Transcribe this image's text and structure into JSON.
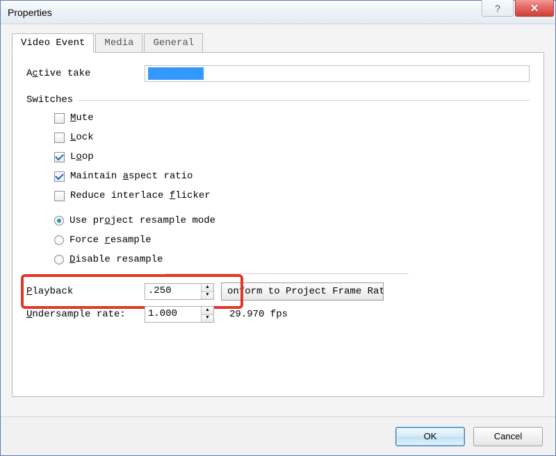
{
  "window": {
    "title": "Properties"
  },
  "tabs": [
    {
      "label": "Video Event",
      "active": true
    },
    {
      "label": "Media",
      "active": false
    },
    {
      "label": "General",
      "active": false
    }
  ],
  "active_take": {
    "label_pre": "A",
    "label_u": "c",
    "label_post": "tive take",
    "value": ""
  },
  "switches": {
    "label": "Switches",
    "mute": {
      "pre": "",
      "u": "M",
      "post": "ute",
      "checked": false
    },
    "lock": {
      "pre": "",
      "u": "L",
      "post": "ock",
      "checked": false
    },
    "loop": {
      "pre": "L",
      "u": "o",
      "post": "op",
      "checked": true
    },
    "aspect": {
      "pre": "Maintain ",
      "u": "a",
      "post": "spect ratio",
      "checked": true
    },
    "flicker": {
      "pre": "Reduce interlace ",
      "u": "f",
      "post": "licker",
      "checked": false
    }
  },
  "resample": {
    "project": {
      "pre": "Use pr",
      "u": "o",
      "post": "ject resample mode",
      "checked": true
    },
    "force": {
      "pre": "Force ",
      "u": "r",
      "post": "esample",
      "checked": false
    },
    "disable": {
      "pre": "",
      "u": "D",
      "post": "isable resample",
      "checked": false
    }
  },
  "playback": {
    "label_u": "P",
    "label_post": "layback",
    "value": ".250",
    "button_text": "onform to Project Frame Rat"
  },
  "undersample": {
    "label_u": "U",
    "label_post": "ndersample rate:",
    "value": "1.000",
    "fps": "29.970 fps"
  },
  "buttons": {
    "ok": "OK",
    "cancel": "Cancel"
  },
  "glyphs": {
    "up": "▲",
    "down": "▼",
    "help": "?",
    "close": "✕"
  }
}
